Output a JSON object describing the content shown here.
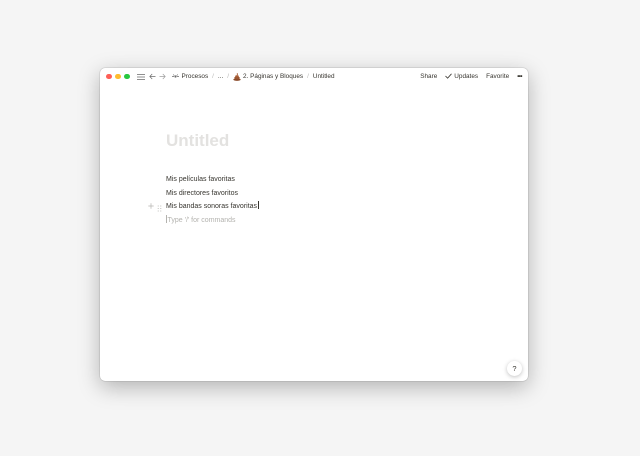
{
  "topbar": {
    "breadcrumbs": [
      {
        "label": "Procesos",
        "icon": "processes-icon"
      },
      {
        "label": "...",
        "icon": ""
      },
      {
        "label": "2. Páginas y Bloques",
        "icon": "poop-emoji-icon"
      },
      {
        "label": "Untitled",
        "icon": ""
      }
    ],
    "share_label": "Share",
    "updates_label": "Updates",
    "favorite_label": "Favorite",
    "more_label": "•••"
  },
  "page": {
    "title": "Untitled",
    "blocks": [
      "Mis películas favoritas",
      "Mis directores favoritos",
      "Mis bandas sonoras favoritas"
    ],
    "placeholder": "Type '/' for commands"
  },
  "help": {
    "label": "?"
  },
  "colors": {
    "close": "#fe5f57",
    "minimize": "#febc2e",
    "zoom": "#28c840",
    "text": "#37352f",
    "title_placeholder": "#e3e2e0",
    "muted": "#b3b2ae"
  }
}
